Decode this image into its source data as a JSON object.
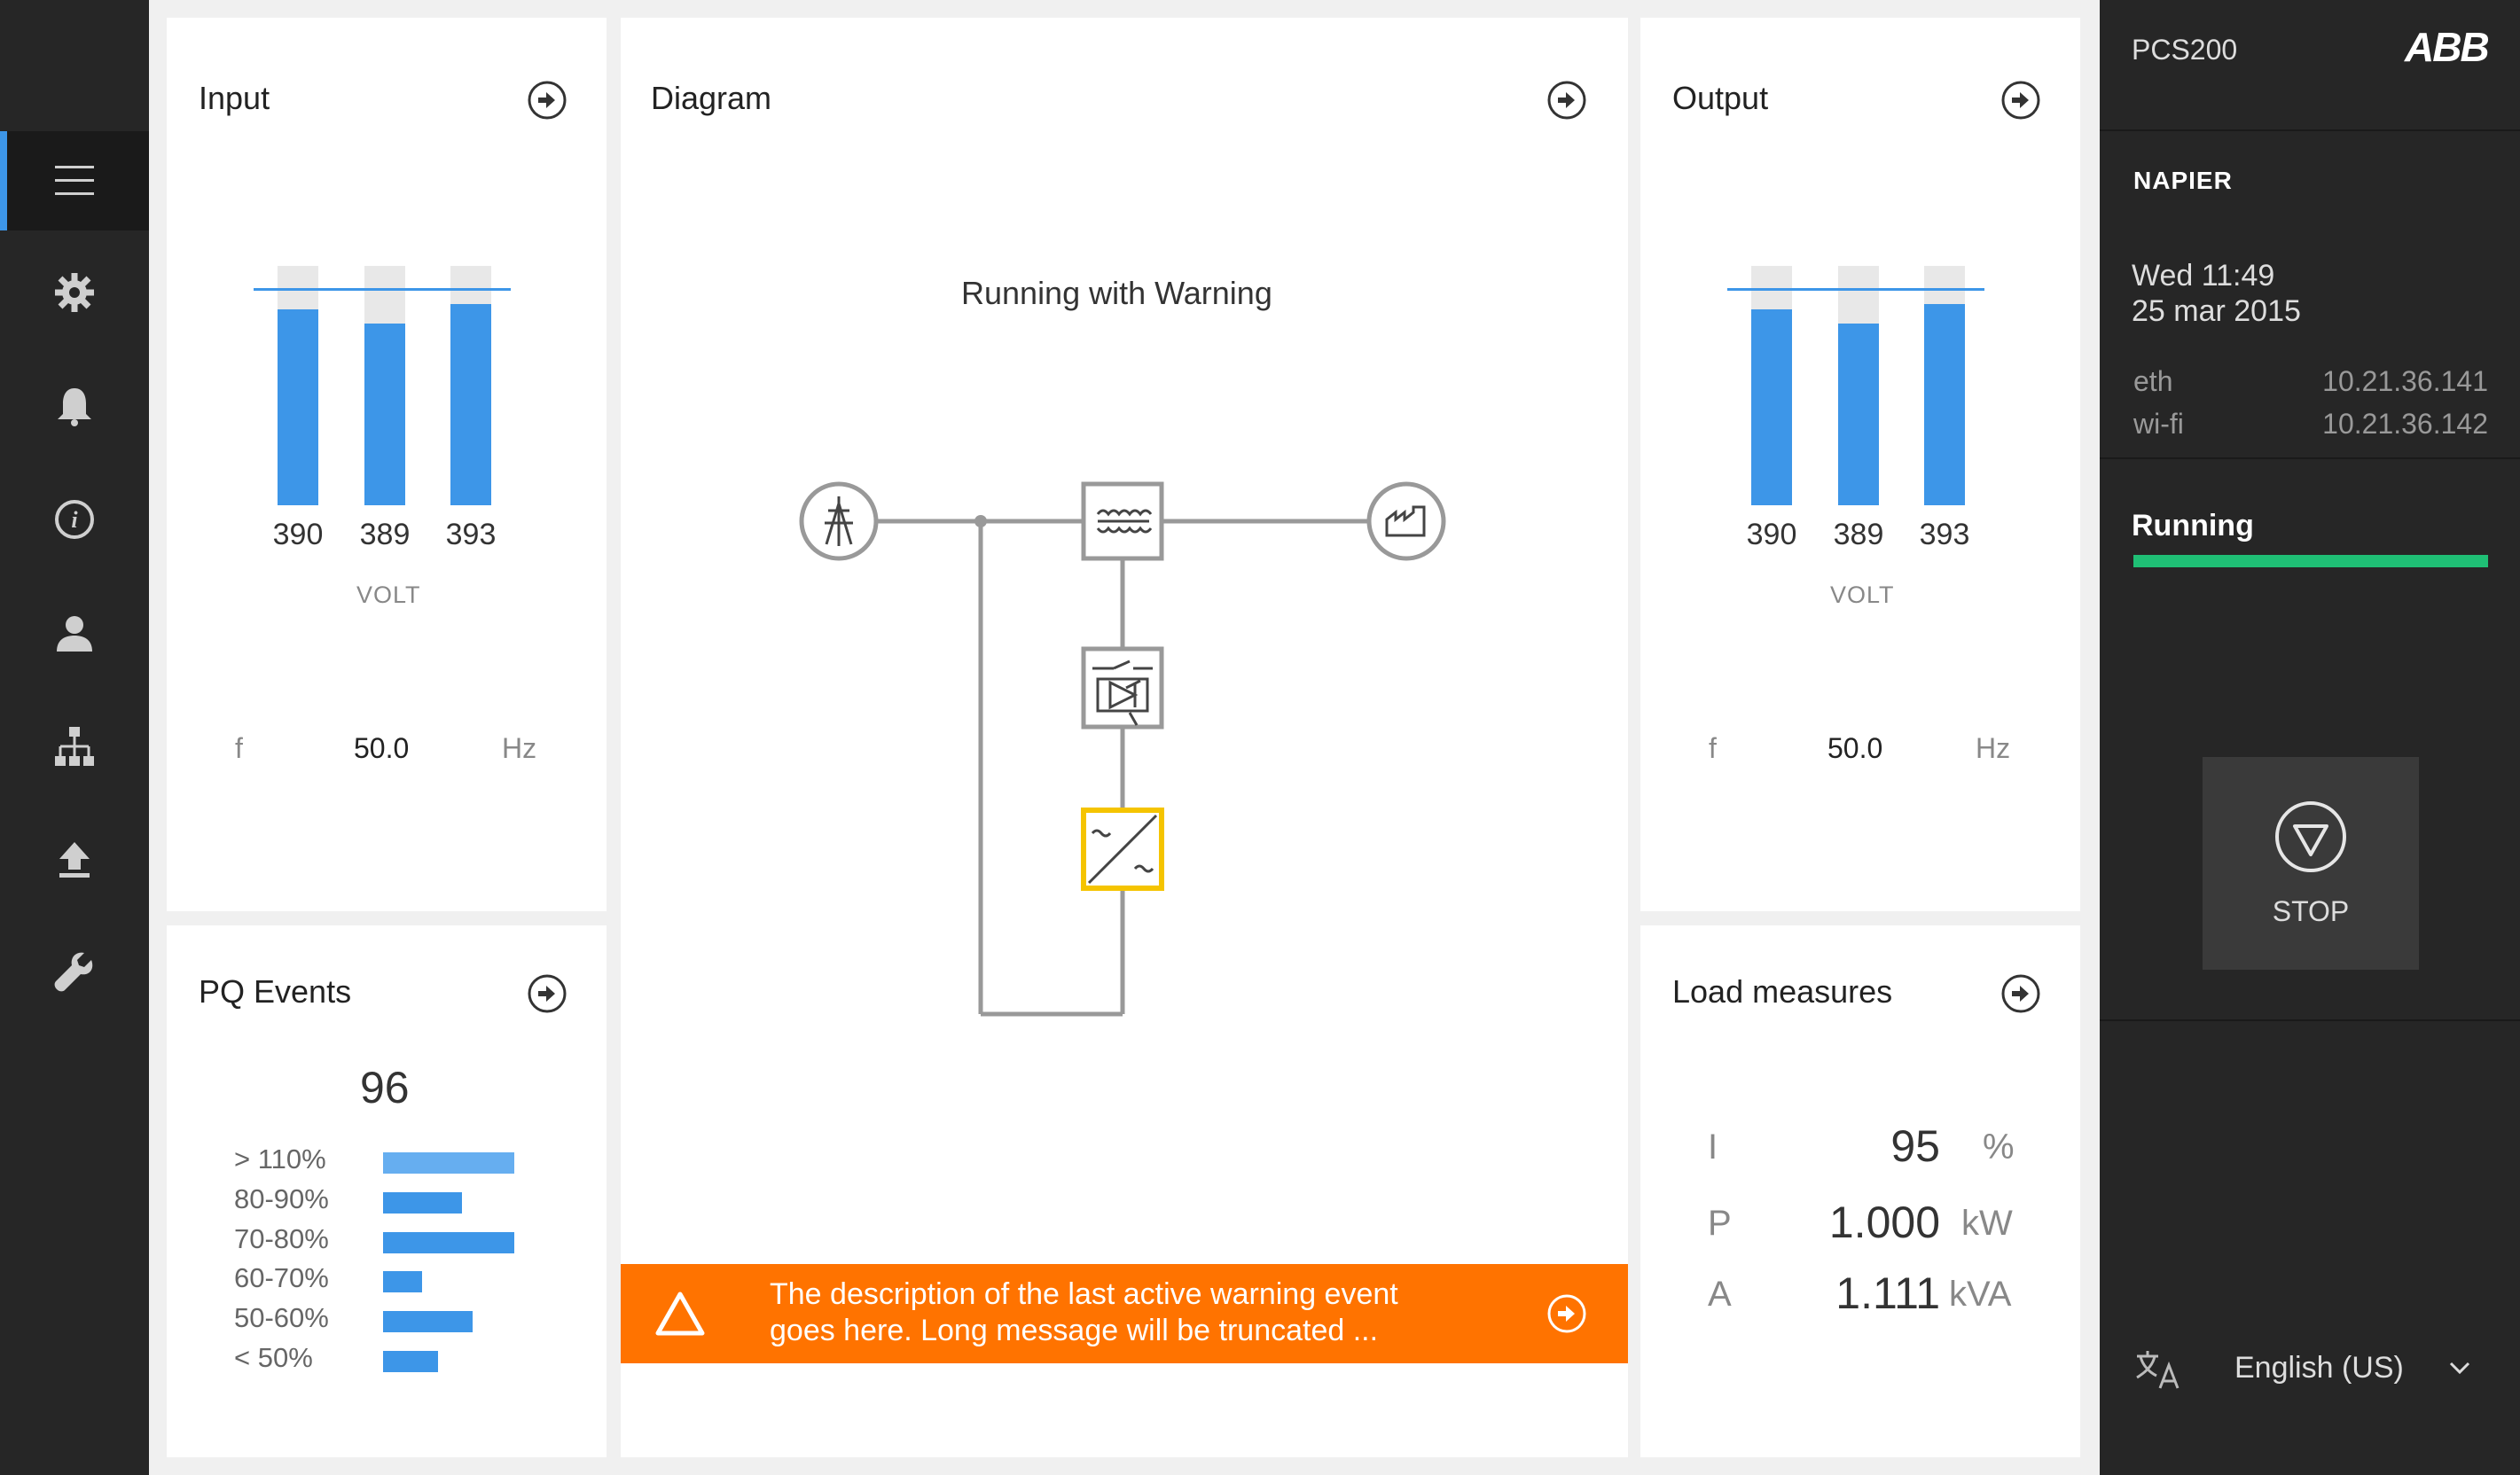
{
  "app": {
    "product": "PCS200",
    "brand": "ABB"
  },
  "nav": {
    "items": [
      {
        "icon": "menu-icon",
        "active": true
      },
      {
        "icon": "gear-icon"
      },
      {
        "icon": "bell-icon"
      },
      {
        "icon": "info-icon"
      },
      {
        "icon": "user-icon"
      },
      {
        "icon": "network-icon"
      },
      {
        "icon": "upload-icon"
      },
      {
        "icon": "wrench-icon"
      }
    ]
  },
  "input": {
    "title": "Input",
    "phases": [
      {
        "value": "390",
        "level": 0.82
      },
      {
        "value": "389",
        "level": 0.76
      },
      {
        "value": "393",
        "level": 0.84
      }
    ],
    "unit": "VOLT",
    "freq_label": "f",
    "freq_value": "50.0",
    "freq_unit": "Hz"
  },
  "output": {
    "title": "Output",
    "phases": [
      {
        "value": "390",
        "level": 0.82
      },
      {
        "value": "389",
        "level": 0.76
      },
      {
        "value": "393",
        "level": 0.84
      }
    ],
    "unit": "VOLT",
    "freq_label": "f",
    "freq_value": "50.0",
    "freq_unit": "Hz"
  },
  "diagram": {
    "title": "Diagram",
    "status": "Running with Warning",
    "converter_color": "#f5c400",
    "warning": {
      "text_line1": "The description of the last active warning event",
      "text_line2": "goes here. Long message will be truncated ...",
      "color": "#ff7300"
    }
  },
  "pq_events": {
    "title": "PQ Events",
    "total": "96",
    "rows": [
      {
        "label": "> 110%",
        "fraction": 1.0,
        "color": "#66aef0"
      },
      {
        "label": "80-90%",
        "fraction": 0.6,
        "color": "#3d96e8"
      },
      {
        "label": "70-80%",
        "fraction": 1.0,
        "color": "#3d96e8"
      },
      {
        "label": "60-70%",
        "fraction": 0.3,
        "color": "#3d96e8"
      },
      {
        "label": "50-60%",
        "fraction": 0.68,
        "color": "#3d96e8"
      },
      {
        "label": "< 50%",
        "fraction": 0.42,
        "color": "#3d96e8"
      }
    ]
  },
  "load_measures": {
    "title": "Load measures",
    "rows": [
      {
        "label": "I",
        "value": "95",
        "unit": "%"
      },
      {
        "label": "P",
        "value": "1.000",
        "unit": "kW"
      },
      {
        "label": "A",
        "value": "1.111",
        "unit": "kVA"
      }
    ]
  },
  "right_panel": {
    "site": "NAPIER",
    "day_time": "Wed 11:49",
    "date": "25 mar 2015",
    "eth_label": "eth",
    "eth_value": "10.21.36.141",
    "wifi_label": "wi-fi",
    "wifi_value": "10.21.36.142",
    "state": "Running",
    "state_color": "#1fbf75",
    "stop_label": "STOP",
    "language": "English (US)"
  },
  "colors": {
    "accent": "#3d96e8",
    "warning": "#ff7300",
    "running": "#1fbf75"
  }
}
